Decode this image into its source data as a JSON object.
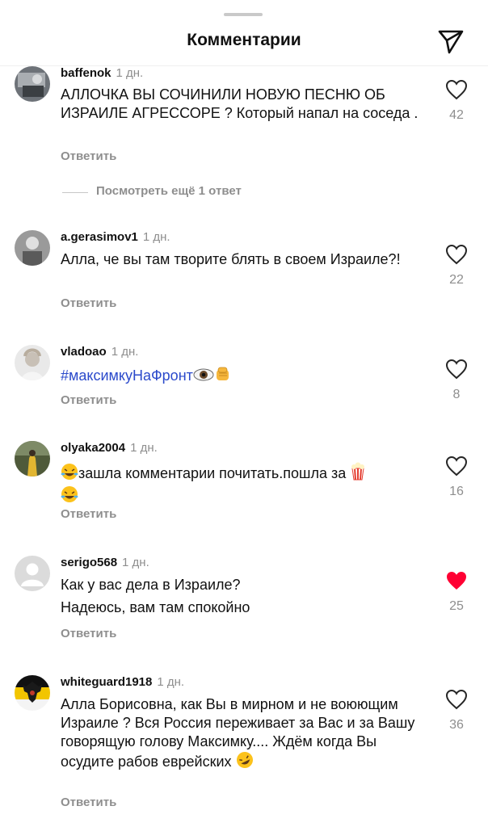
{
  "header": {
    "title": "Комментарии",
    "share_icon": "send-icon"
  },
  "comments": [
    {
      "username": "baffenok",
      "time": "1 дн.",
      "text": "АЛЛОЧКА ВЫ СОЧИНИЛИ НОВУЮ ПЕСНЮ ОБ ИЗРАИЛЕ АГРЕССОРЕ ? Который напал на соседа .",
      "likes": "42",
      "reply": "Ответить",
      "liked": false
    },
    {
      "username": "a.gerasimov1",
      "time": "1 дн.",
      "text": "Алла, че вы там творите блять в своем Израиле?!",
      "likes": "22",
      "reply": "Ответить",
      "liked": false
    },
    {
      "username": "vladoao",
      "time": "1 дн.",
      "text": "#максимкуНаФронт",
      "likes": "8",
      "reply": "Ответить",
      "liked": false
    },
    {
      "username": "olyaka2004",
      "time": "1 дн.",
      "text": "зашла комментарии почитать.пошла за",
      "likes": "16",
      "reply": "Ответить",
      "liked": false
    },
    {
      "username": "serigo568",
      "time": "1 дн.",
      "text_line1": "Как у вас дела в Израиле?",
      "text_line2": "Надеюсь, вам там спокойно",
      "likes": "25",
      "reply": "Ответить",
      "liked": true
    },
    {
      "username": "whiteguard1918",
      "time": "1 дн.",
      "text": "Алла Борисовна, как Вы в мирном и не воюющим Израиле ? Вся Россия переживает за Вас и за Вашу говорящую голову Максимку.... Ждём когда Вы осудите рабов еврейских",
      "likes": "36",
      "reply": "Ответить",
      "liked": false
    }
  ],
  "view_more_replies": "Посмотреть ещё 1 ответ",
  "colors": {
    "like_active": "#ff0033",
    "hashtag": "#2b4acb",
    "secondary": "#8e8e8e"
  }
}
